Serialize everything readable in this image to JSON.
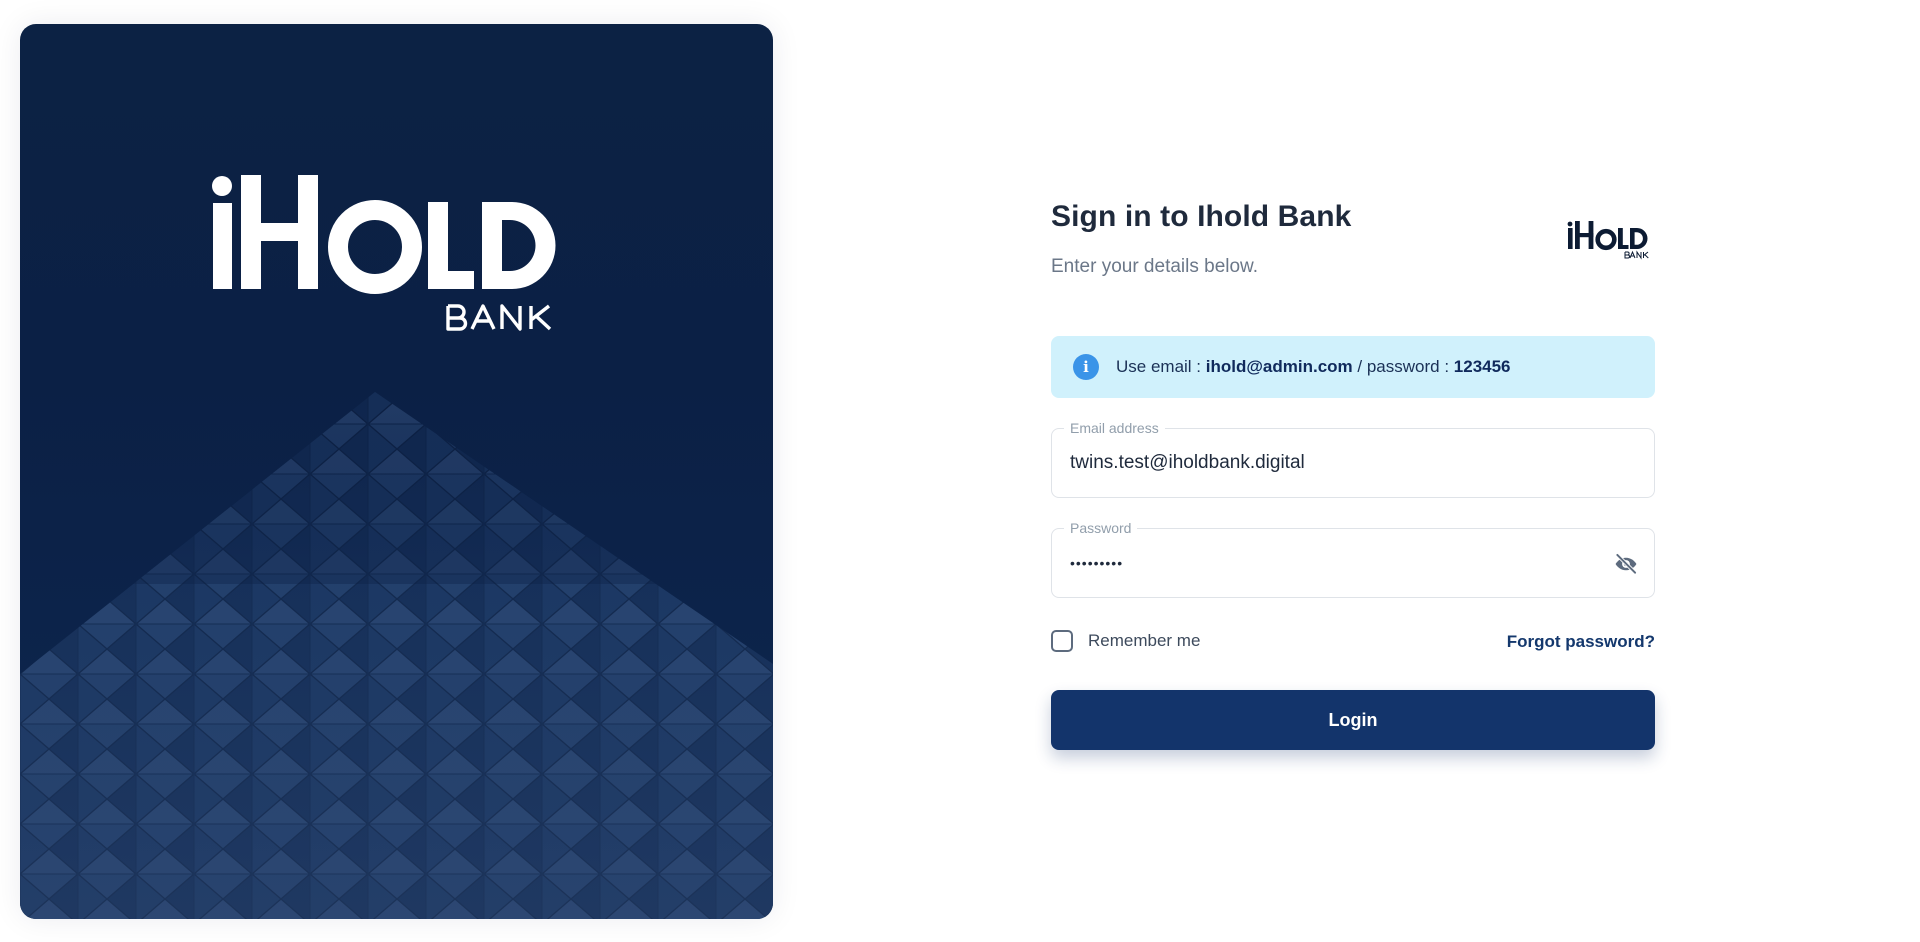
{
  "brand": {
    "name": "iHOLD",
    "sub": "BANK",
    "navy": "#13346b",
    "hero_background": "#0c2244"
  },
  "header": {
    "title": "Sign in to Ihold Bank",
    "subtitle": "Enter your details below."
  },
  "alert": {
    "icon": "info-icon",
    "prefix": "Use email : ",
    "email": "ihold@admin.com",
    "separator": " / password : ",
    "password": "123456",
    "color": "#d0f1fc"
  },
  "form": {
    "email_label": "Email address",
    "email_value": "twins.test@iholdbank.digital",
    "password_label": "Password",
    "password_value": "•••••••••",
    "password_toggle_icon": "eye-off-icon",
    "remember_label": "Remember me",
    "remember_checked": false,
    "forgot_label": "Forgot password?",
    "login_label": "Login"
  }
}
